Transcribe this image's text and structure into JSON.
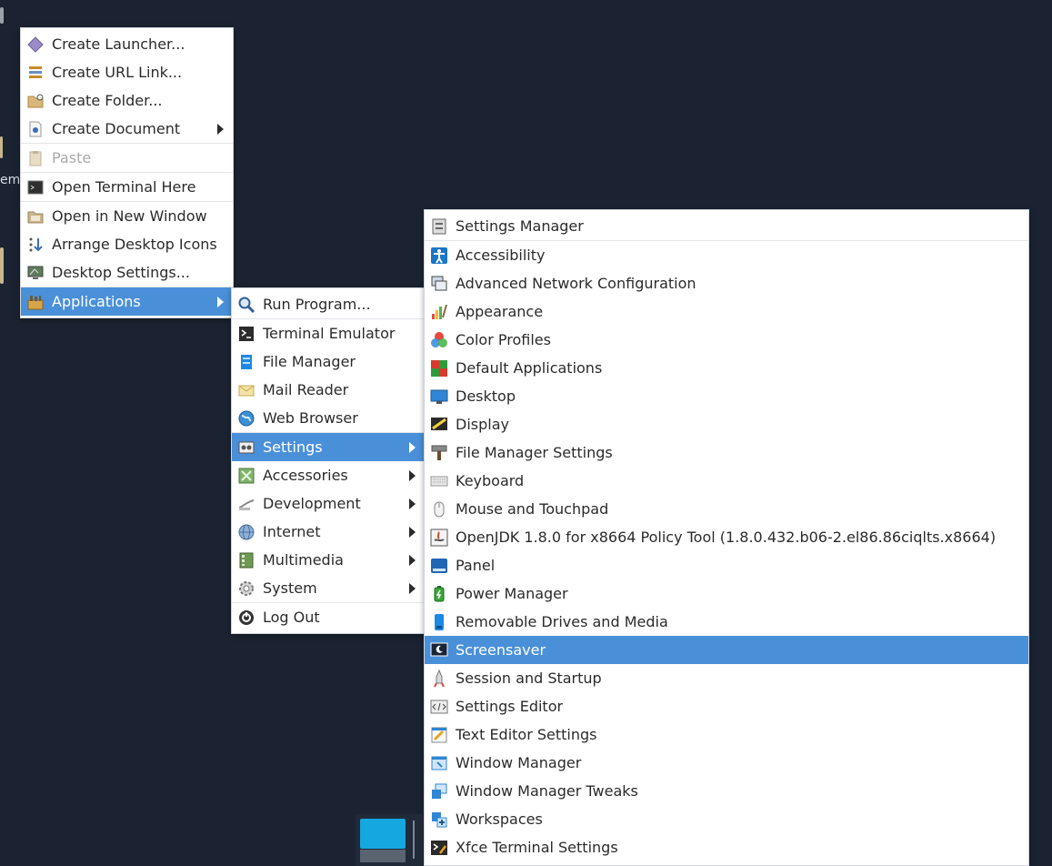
{
  "desktop": {
    "fragment_text": "em"
  },
  "desktop_menu": {
    "items": [
      {
        "label": "Create Launcher...",
        "icon": "launcher-icon"
      },
      {
        "label": "Create URL Link...",
        "icon": "url-link-icon"
      },
      {
        "label": "Create Folder...",
        "icon": "folder-icon"
      },
      {
        "label": "Create Document",
        "icon": "document-icon",
        "submenu": true
      },
      {
        "label": "Paste",
        "icon": "paste-icon",
        "disabled": true
      },
      {
        "label": "Open Terminal Here",
        "icon": "terminal-icon"
      },
      {
        "label": "Open in New Window",
        "icon": "new-window-icon"
      },
      {
        "label": "Arrange Desktop Icons",
        "icon": "arrange-icon"
      },
      {
        "label": "Desktop Settings...",
        "icon": "desktop-settings-icon"
      },
      {
        "label": "Applications",
        "icon": "applications-icon",
        "submenu": true,
        "selected": true
      }
    ]
  },
  "applications_menu": {
    "items": [
      {
        "label": "Run Program...",
        "icon": "run-program-icon"
      },
      {
        "label": "Terminal Emulator",
        "icon": "terminal-icon"
      },
      {
        "label": "File Manager",
        "icon": "file-manager-icon"
      },
      {
        "label": "Mail Reader",
        "icon": "mail-icon"
      },
      {
        "label": "Web Browser",
        "icon": "web-browser-icon"
      },
      {
        "label": "Settings",
        "icon": "settings-icon",
        "submenu": true,
        "selected": true
      },
      {
        "label": "Accessories",
        "icon": "accessories-icon",
        "submenu": true
      },
      {
        "label": "Development",
        "icon": "development-icon",
        "submenu": true
      },
      {
        "label": "Internet",
        "icon": "internet-icon",
        "submenu": true
      },
      {
        "label": "Multimedia",
        "icon": "multimedia-icon",
        "submenu": true
      },
      {
        "label": "System",
        "icon": "system-icon",
        "submenu": true
      },
      {
        "label": "Log Out",
        "icon": "log-out-icon"
      }
    ]
  },
  "settings_menu": {
    "items": [
      {
        "label": "Settings Manager",
        "icon": "settings-manager-icon"
      },
      {
        "label": "Accessibility",
        "icon": "accessibility-icon"
      },
      {
        "label": "Advanced Network Configuration",
        "icon": "network-icon"
      },
      {
        "label": "Appearance",
        "icon": "appearance-icon"
      },
      {
        "label": "Color Profiles",
        "icon": "color-profiles-icon"
      },
      {
        "label": "Default Applications",
        "icon": "default-applications-icon"
      },
      {
        "label": "Desktop",
        "icon": "desktop-icon"
      },
      {
        "label": "Display",
        "icon": "display-icon"
      },
      {
        "label": "File Manager Settings",
        "icon": "file-manager-settings-icon"
      },
      {
        "label": "Keyboard",
        "icon": "keyboard-icon"
      },
      {
        "label": "Mouse and Touchpad",
        "icon": "mouse-icon"
      },
      {
        "label": "OpenJDK 1.8.0 for x8664 Policy Tool (1.8.0.432.b06-2.el86.86ciqlts.x8664)",
        "icon": "java-policy-icon"
      },
      {
        "label": "Panel",
        "icon": "panel-icon"
      },
      {
        "label": "Power Manager",
        "icon": "power-manager-icon"
      },
      {
        "label": "Removable Drives and Media",
        "icon": "removable-drives-icon"
      },
      {
        "label": "Screensaver",
        "icon": "screensaver-icon",
        "selected": true
      },
      {
        "label": "Session and Startup",
        "icon": "session-startup-icon"
      },
      {
        "label": "Settings Editor",
        "icon": "settings-editor-icon"
      },
      {
        "label": "Text Editor Settings",
        "icon": "text-editor-icon"
      },
      {
        "label": "Window Manager",
        "icon": "window-manager-icon"
      },
      {
        "label": "Window Manager Tweaks",
        "icon": "window-manager-tweaks-icon"
      },
      {
        "label": "Workspaces",
        "icon": "workspaces-icon"
      },
      {
        "label": "Xfce Terminal Settings",
        "icon": "terminal-settings-icon"
      }
    ]
  },
  "colors": {
    "desktop_bg": "#1b2332",
    "highlight": "#4a90d9",
    "menu_bg": "#ffffff"
  }
}
